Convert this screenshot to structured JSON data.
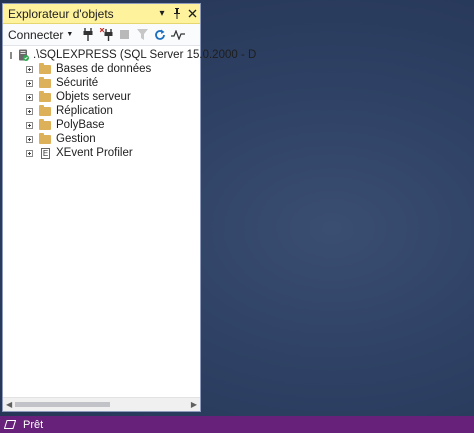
{
  "explorer": {
    "title": "Explorateur d'objets",
    "toolbar": {
      "connect_label": "Connecter"
    },
    "tree": {
      "root_label": ".\\SQLEXPRESS (SQL Server 15.0.2000 - D",
      "children": [
        {
          "label": "Bases de données",
          "icon": "folder-icon"
        },
        {
          "label": "Sécurité",
          "icon": "folder-icon"
        },
        {
          "label": "Objets serveur",
          "icon": "folder-icon"
        },
        {
          "label": "Réplication",
          "icon": "folder-icon"
        },
        {
          "label": "PolyBase",
          "icon": "folder-icon"
        },
        {
          "label": "Gestion",
          "icon": "folder-icon"
        },
        {
          "label": "XEvent Profiler",
          "icon": "xevent-icon"
        }
      ]
    }
  },
  "statusbar": {
    "text": "Prêt"
  },
  "colors": {
    "title_bg": "#fff29d",
    "statusbar_bg": "#68217a",
    "workspace_bg": "#2e4164"
  }
}
